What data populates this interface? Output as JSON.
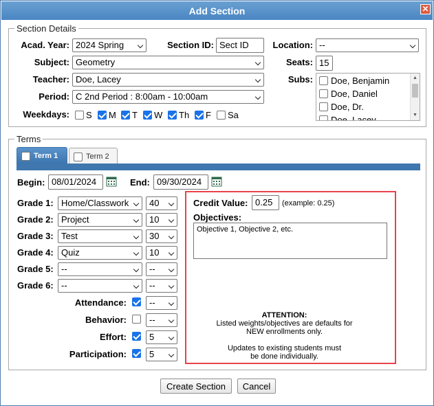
{
  "title": "Add Section",
  "section_details": {
    "legend": "Section Details",
    "acad_year_label": "Acad. Year:",
    "acad_year_value": "2024 Spring",
    "section_id_label": "Section ID:",
    "section_id_value": "Sect ID",
    "location_label": "Location:",
    "location_value": "--",
    "subject_label": "Subject:",
    "subject_value": "Geometry",
    "seats_label": "Seats:",
    "seats_value": "15",
    "teacher_label": "Teacher:",
    "teacher_value": "Doe, Lacey",
    "subs_label": "Subs:",
    "subs": [
      "Doe, Benjamin",
      "Doe, Daniel",
      "Doe, Dr.",
      "Doe, Lacey"
    ],
    "period_label": "Period:",
    "period_value": "C 2nd Period : 8:00am - 10:00am",
    "weekdays_label": "Weekdays:",
    "weekdays": [
      {
        "label": "S",
        "checked": false
      },
      {
        "label": "M",
        "checked": true
      },
      {
        "label": "T",
        "checked": true
      },
      {
        "label": "W",
        "checked": true
      },
      {
        "label": "Th",
        "checked": true
      },
      {
        "label": "F",
        "checked": true
      },
      {
        "label": "Sa",
        "checked": false
      }
    ]
  },
  "terms": {
    "legend": "Terms",
    "tabs": [
      {
        "label": "Term 1",
        "active": true
      },
      {
        "label": "Term 2",
        "active": false
      }
    ],
    "begin_label": "Begin:",
    "begin_value": "08/01/2024",
    "end_label": "End:",
    "end_value": "09/30/2024",
    "grades": [
      {
        "label": "Grade 1:",
        "category": "Home/Classwork",
        "weight": "40"
      },
      {
        "label": "Grade 2:",
        "category": "Project",
        "weight": "10"
      },
      {
        "label": "Grade 3:",
        "category": "Test",
        "weight": "30"
      },
      {
        "label": "Grade 4:",
        "category": "Quiz",
        "weight": "10"
      },
      {
        "label": "Grade 5:",
        "category": "--",
        "weight": "--"
      },
      {
        "label": "Grade 6:",
        "category": "--",
        "weight": "--"
      }
    ],
    "extras": [
      {
        "label": "Attendance:",
        "checked": true,
        "weight": "--"
      },
      {
        "label": "Behavior:",
        "checked": false,
        "weight": "--"
      },
      {
        "label": "Effort:",
        "checked": true,
        "weight": "5"
      },
      {
        "label": "Participation:",
        "checked": true,
        "weight": "5"
      }
    ],
    "credit_value_label": "Credit Value:",
    "credit_value": "0.25",
    "credit_example": "(example: 0.25)",
    "objectives_label": "Objectives:",
    "objectives_value": "Objective 1, Objective 2, etc.",
    "attention_title": "ATTENTION:",
    "attention_line1": "Listed weights/objectives are defaults for",
    "attention_line2": "NEW enrollments only.",
    "attention_line3": "Updates to existing students must",
    "attention_line4": "be done individually."
  },
  "buttons": {
    "create": "Create Section",
    "cancel": "Cancel"
  }
}
